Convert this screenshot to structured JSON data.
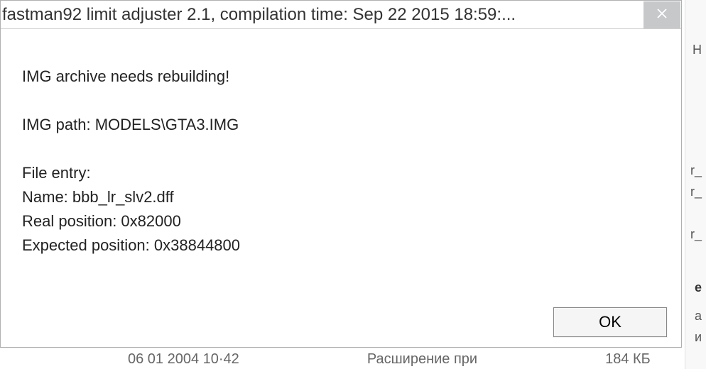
{
  "dialog": {
    "title": "fastman92 limit adjuster 2.1, compilation time: Sep 22 2015 18:59:...",
    "message": {
      "heading": "IMG archive needs rebuilding!",
      "path_label": "IMG path: MODELS\\GTA3.IMG",
      "entry_header": "File entry:",
      "name_line": "Name: bbb_lr_slv2.dff",
      "real_pos_line": "Real position: 0x82000",
      "expected_pos_line": "Expected position: 0x38844800"
    },
    "ok_label": "OK"
  },
  "background": {
    "bottom_date": "06 01 2004 10·42",
    "bottom_text": "Расширение при",
    "bottom_size": "184 КБ",
    "right_chars": [
      "Н",
      "r_",
      "r_",
      "r_",
      "e",
      "а",
      "и"
    ]
  }
}
